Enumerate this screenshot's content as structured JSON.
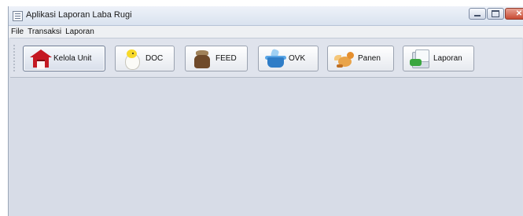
{
  "window": {
    "title": "Aplikasi Laporan Laba Rugi"
  },
  "menubar": {
    "items": [
      {
        "label": "File"
      },
      {
        "label": "Transaksi"
      },
      {
        "label": "Laporan"
      }
    ]
  },
  "toolbar": {
    "buttons": [
      {
        "label": "Kelola Unit",
        "icon": "house-icon",
        "active": true
      },
      {
        "label": "DOC",
        "icon": "chick-egg-icon",
        "active": false
      },
      {
        "label": "FEED",
        "icon": "feed-sack-icon",
        "active": false
      },
      {
        "label": "OVK",
        "icon": "medicine-bag-icon",
        "active": false
      },
      {
        "label": "Panen",
        "icon": "bird-icon",
        "active": false
      },
      {
        "label": "Laporan",
        "icon": "report-icon",
        "active": false
      }
    ]
  },
  "window_controls": {
    "close_glyph": "✕"
  }
}
